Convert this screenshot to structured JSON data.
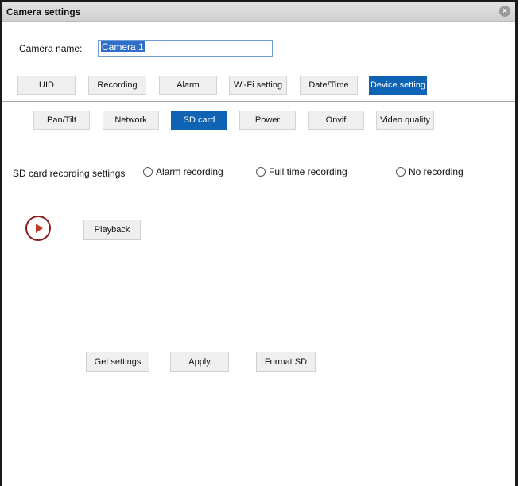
{
  "window": {
    "title": "Camera settings"
  },
  "camera_name": {
    "label": "Camera name:",
    "value": "Camera 1"
  },
  "tabs": [
    {
      "label": "UID"
    },
    {
      "label": "Recording"
    },
    {
      "label": "Alarm"
    },
    {
      "label": "Wi-Fi setting"
    },
    {
      "label": "Date/Time"
    },
    {
      "label": "Device setting"
    }
  ],
  "subtabs": [
    {
      "label": "Pan/Tilt"
    },
    {
      "label": "Network"
    },
    {
      "label": "SD card"
    },
    {
      "label": "Power"
    },
    {
      "label": "Onvif"
    },
    {
      "label": "Video quality"
    }
  ],
  "sd_section": {
    "label": "SD card recording settings",
    "options": [
      {
        "label": "Alarm recording"
      },
      {
        "label": "Full time recording"
      },
      {
        "label": "No recording"
      }
    ]
  },
  "playback_label": "Playback",
  "actions": {
    "get_settings": "Get settings",
    "apply": "Apply",
    "format_sd": "Format SD"
  },
  "colors": {
    "accent": "#0f63b4",
    "play_icon": "#8b1a1a"
  }
}
